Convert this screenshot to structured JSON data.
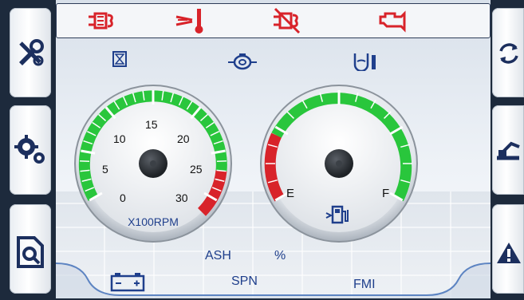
{
  "rpm_gauge": {
    "tick_labels": [
      "0",
      "5",
      "10",
      "15",
      "20",
      "25",
      "30"
    ],
    "unit_label": "X100RPM"
  },
  "fuel_gauge": {
    "empty_label": "E",
    "full_label": "F"
  },
  "bottom": {
    "ash_label": "ASH",
    "percent_label": "%",
    "spn_label": "SPN",
    "fmi_label": "FMI"
  },
  "colors": {
    "warning_red": "#d8232a",
    "frame_dark": "#1d2a3c",
    "label_blue": "#1f3f8c",
    "gauge_green": "#29c63c"
  },
  "icons": {
    "top": [
      "diesel-particulate-filter-icon",
      "coolant-temperature-icon",
      "dpf-regeneration-inhibit-icon",
      "check-engine-icon"
    ],
    "left": [
      "tools-settings-icon",
      "gears-config-icon",
      "diagnostic-document-icon"
    ],
    "right": [
      "refresh-icon",
      "machine-icon",
      "warning-icon"
    ],
    "middle": [
      "hourglass-icon",
      "engine-oil-pressure-icon",
      "hydraulic-oil-level-icon"
    ],
    "bottom": [
      "battery-icon",
      "fuel-pump-icon"
    ]
  }
}
